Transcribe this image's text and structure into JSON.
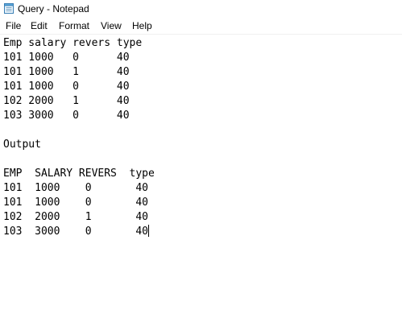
{
  "window": {
    "title": "Query - Notepad",
    "icon": "notepad-icon"
  },
  "menu": {
    "items": [
      "File",
      "Edit",
      "Format",
      "View",
      "Help"
    ]
  },
  "document": {
    "lines": [
      "Emp salary revers type",
      "101 1000   0      40",
      "101 1000   1      40",
      "101 1000   0      40",
      "102 2000   1      40",
      "103 3000   0      40",
      "",
      "Output",
      "",
      "EMP  SALARY REVERS  type",
      "101  1000    0       40",
      "101  1000    0       40",
      "102  2000    1       40",
      "103  3000    0       40"
    ]
  }
}
